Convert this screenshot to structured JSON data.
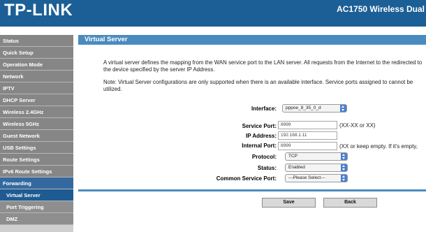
{
  "header": {
    "logo": "TP-LINK",
    "model": "AC1750 Wireless Dual"
  },
  "sidebar": {
    "items": [
      {
        "label": "Status"
      },
      {
        "label": "Quick Setup"
      },
      {
        "label": "Operation Mode"
      },
      {
        "label": "Network"
      },
      {
        "label": "IPTV"
      },
      {
        "label": "DHCP Server"
      },
      {
        "label": "Wireless 2.4GHz"
      },
      {
        "label": "Wireless 5GHz"
      },
      {
        "label": "Guest Network"
      },
      {
        "label": "USB Settings"
      },
      {
        "label": "Route Settings"
      },
      {
        "label": "IPv6 Route Settings"
      },
      {
        "label": "Forwarding"
      },
      {
        "label": "Virtual Server"
      },
      {
        "label": "Port Triggering"
      },
      {
        "label": "DMZ"
      }
    ]
  },
  "main": {
    "title": "Virtual Server",
    "description": "A virtual server defines the mapping from the WAN service port to the LAN server. All requests from the Internet to the redirected to the device specified by the server IP Address.",
    "note": "Note: Virtual Server configurations are only supported when there is an available interface. Service ports assigned to cannot be utilized.",
    "form": {
      "interface_label": "Interface:",
      "interface_value": "pppoe_8_35_0_d",
      "service_port_label": "Service Port:",
      "service_port_value": "8999",
      "service_port_hint": "(XX-XX or XX)",
      "ip_address_label": "IP Address:",
      "ip_address_value": "192.168.1.11",
      "internal_port_label": "Internal Port:",
      "internal_port_value": "8999",
      "internal_port_hint": "(XX or keep empty. If it's empty,",
      "protocol_label": "Protocol:",
      "protocol_value": "TCP",
      "status_label": "Status:",
      "status_value": "Enabled",
      "common_service_port_label": "Common Service Port:",
      "common_service_port_value": "---Please Select---"
    },
    "buttons": {
      "save": "Save",
      "back": "Back"
    }
  },
  "colors": {
    "header": "#1b5f96",
    "section_bar": "#4a8bbf",
    "sidebar_item": "#868686",
    "sidebar_active": "#1e5b93",
    "select_arrow": "#4a7fd0"
  },
  "icons": {
    "select": "select-arrows-icon"
  }
}
